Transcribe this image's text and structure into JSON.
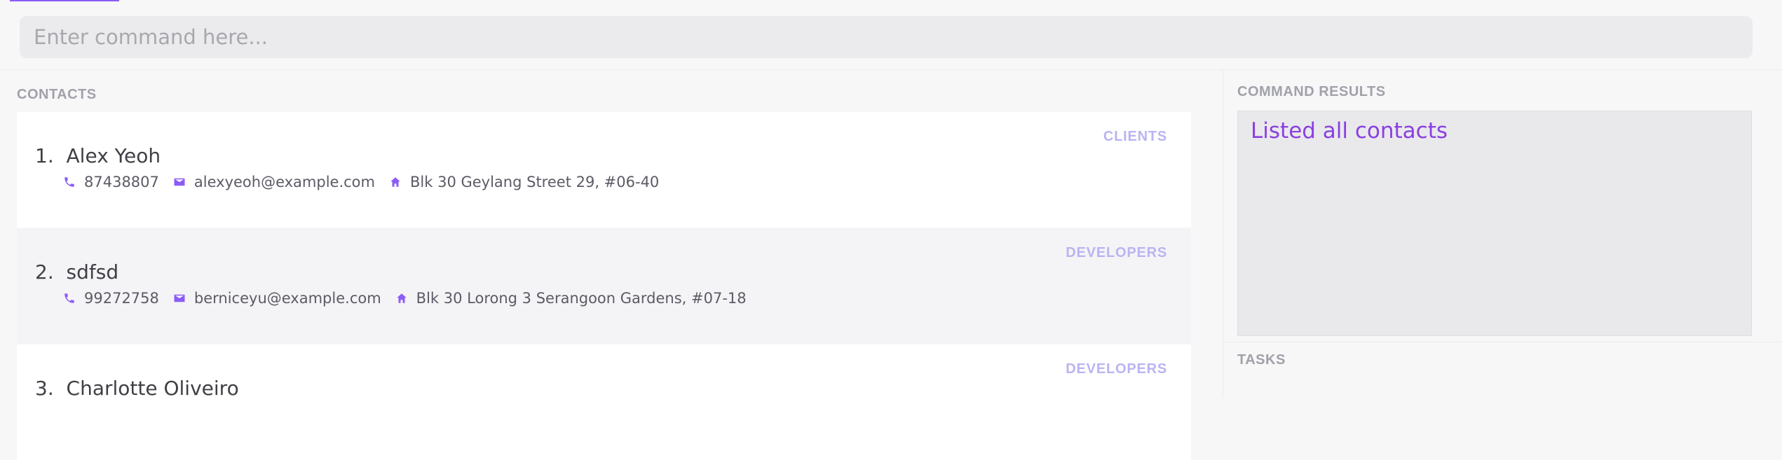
{
  "command": {
    "placeholder": "Enter command here..."
  },
  "contacts": {
    "title": "CONTACTS",
    "items": [
      {
        "index": "1.",
        "name": "Alex Yeoh",
        "tag": "CLIENTS",
        "phone": "87438807",
        "email": "alexyeoh@example.com",
        "address": "Blk 30 Geylang Street 29, #06-40"
      },
      {
        "index": "2.",
        "name": "sdfsd",
        "tag": "DEVELOPERS",
        "phone": "99272758",
        "email": "berniceyu@example.com",
        "address": "Blk 30 Lorong 3 Serangoon Gardens, #07-18"
      },
      {
        "index": "3.",
        "name": "Charlotte Oliveiro",
        "tag": "DEVELOPERS",
        "phone": "",
        "email": "",
        "address": ""
      }
    ]
  },
  "results": {
    "title": "COMMAND RESULTS",
    "message": "Listed all contacts"
  },
  "tasks": {
    "title": "TASKS"
  },
  "icons": {
    "phone": "phone-icon",
    "email": "mail-icon",
    "address": "home-icon"
  },
  "colors": {
    "accent": "#8b5cf6",
    "tag": "#b9b4f2",
    "result_text": "#8b3fe0"
  }
}
